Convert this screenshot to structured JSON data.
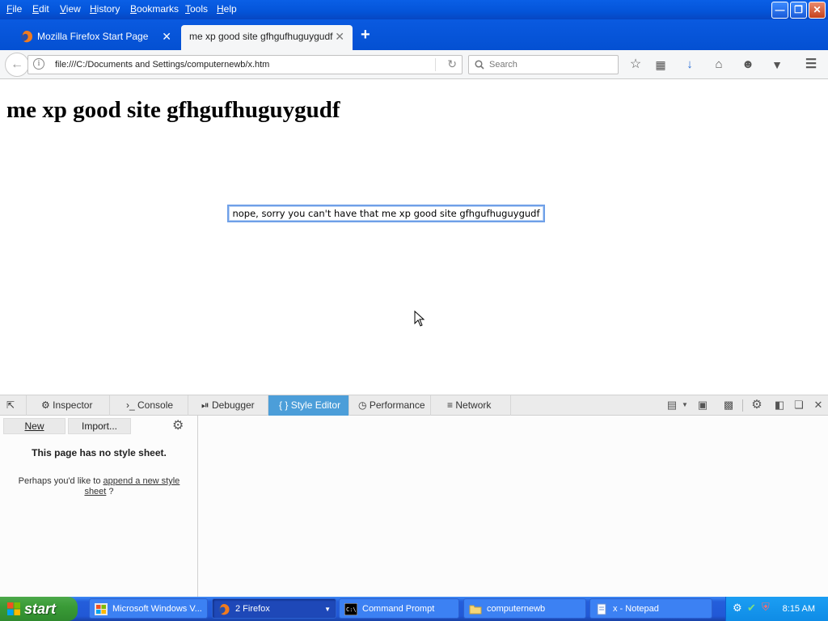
{
  "menubar": {
    "items": [
      "File",
      "Edit",
      "View",
      "History",
      "Bookmarks",
      "Tools",
      "Help"
    ]
  },
  "tabs": [
    {
      "label": "Mozilla Firefox Start Page",
      "active": false
    },
    {
      "label": "me xp good site gfhgufhuguygudf",
      "active": true
    }
  ],
  "navbar": {
    "url": "file:///C:/Documents and Settings/computernewb/x.htm",
    "search_placeholder": "Search"
  },
  "page": {
    "heading": "me xp good site gfhgufhuguygudf",
    "message": "nope, sorry you can't have that me xp good site gfhgufhuguygudf"
  },
  "devtools": {
    "tabs": [
      "Inspector",
      "Console",
      "Debugger",
      "Style Editor",
      "Performance",
      "Network"
    ],
    "selected_tab": "Style Editor",
    "new_label": "New",
    "import_label": "Import...",
    "no_sheet": "This page has no style sheet.",
    "perhaps_prefix": "Perhaps you'd like to",
    "perhaps_link": "append a new style sheet",
    "perhaps_suffix": "?"
  },
  "taskbar": {
    "start_label": "start",
    "tasks": [
      {
        "label": "Microsoft Windows V...",
        "icon": "windows-icon"
      },
      {
        "label": "2 Firefox",
        "icon": "firefox-icon",
        "active": true
      },
      {
        "label": "Command Prompt",
        "icon": "cmd-icon"
      },
      {
        "label": "computernewb",
        "icon": "folder-icon"
      },
      {
        "label": "x - Notepad",
        "icon": "notepad-icon"
      }
    ],
    "clock": "8:15 AM"
  },
  "colors": {
    "xp_blue": "#0454d8",
    "devtools_selected": "#4c9ed9",
    "start_green": "#3a9b37"
  }
}
